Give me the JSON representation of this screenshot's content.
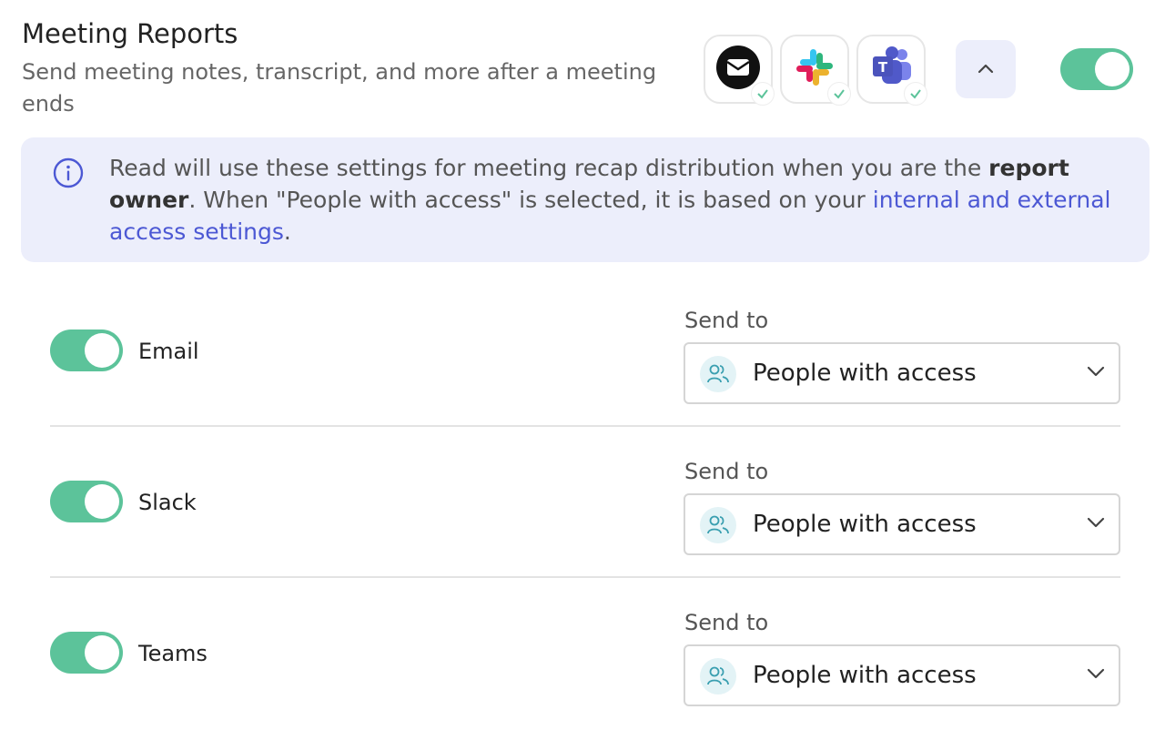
{
  "header": {
    "title": "Meeting Reports",
    "subtitle": "Send meeting notes, transcript, and more after a meeting ends"
  },
  "apps": [
    {
      "name": "email-app-icon",
      "status": "connected"
    },
    {
      "name": "slack-app-icon",
      "status": "connected"
    },
    {
      "name": "teams-app-icon",
      "status": "connected"
    }
  ],
  "master_toggle": {
    "state": "on"
  },
  "info": {
    "text_before": "Read will use these settings for meeting recap distribution when you are the ",
    "bold": "report owner",
    "text_middle": ". When \"People with access\" is selected, it is based on your ",
    "link": "internal and external access settings",
    "text_after": "."
  },
  "channels": [
    {
      "label": "Email",
      "send_to_label": "Send to",
      "value": "People with access",
      "enabled": true
    },
    {
      "label": "Slack",
      "send_to_label": "Send to",
      "value": "People with access",
      "enabled": true
    },
    {
      "label": "Teams",
      "send_to_label": "Send to",
      "value": "People with access",
      "enabled": true
    }
  ],
  "colors": {
    "accent_green": "#5cc39a",
    "info_bg": "#eceefb",
    "link_blue": "#4c58d4"
  }
}
